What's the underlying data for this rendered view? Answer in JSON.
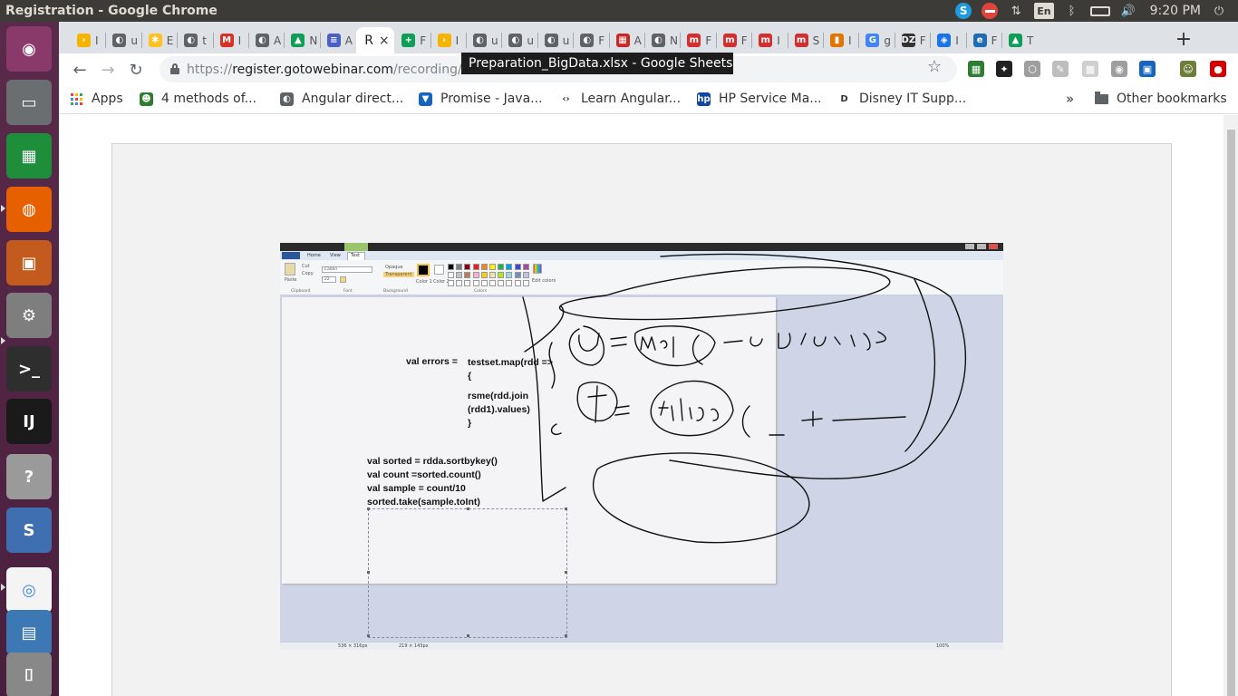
{
  "window": {
    "title": "Registration - Google Chrome"
  },
  "system_tray": {
    "skype_letter": "S",
    "keyboard_layout": "En",
    "bluetooth_glyph": "ᛒ",
    "network_glyph": "⇅",
    "volume_glyph": "🔊",
    "clock": "9:20 PM",
    "power_glyph": "⏻"
  },
  "launcher": [
    {
      "name": "ubuntu-dash",
      "color": "#8a3a6a",
      "glyph": "◉"
    },
    {
      "name": "files",
      "color": "#6b6e70",
      "glyph": "▭"
    },
    {
      "name": "libreoffice-calc",
      "color": "#1f8e3a",
      "glyph": "▦"
    },
    {
      "name": "firefox",
      "color": "#e66000",
      "glyph": "◍"
    },
    {
      "name": "libreoffice-impress",
      "color": "#c35b1e",
      "glyph": "▣"
    },
    {
      "name": "system-settings",
      "color": "#7e7e7e",
      "glyph": "⚙"
    },
    {
      "name": "terminal",
      "color": "#2e2e2e",
      "glyph": ">_"
    },
    {
      "name": "intellij-idea",
      "color": "#1a1a1a",
      "glyph": "IJ"
    },
    {
      "name": "help",
      "color": "#9a9a9a",
      "glyph": "?"
    },
    {
      "name": "stacked-apps",
      "color": "#3f6fb0",
      "glyph": "S"
    },
    {
      "name": "chrome",
      "color": "#f4f4f4",
      "glyph": "◎"
    },
    {
      "name": "virtualbox",
      "color": "#3c78b4",
      "glyph": "▤"
    },
    {
      "name": "disks",
      "color": "#888888",
      "glyph": "⌷"
    }
  ],
  "tabs": [
    {
      "label": "I",
      "favicon_color": "#f4b400",
      "glyph": "›"
    },
    {
      "label": "u",
      "favicon_color": "#5f6368",
      "glyph": "◐"
    },
    {
      "label": "E",
      "favicon_color": "#ffc220",
      "glyph": "✱"
    },
    {
      "label": "t",
      "favicon_color": "#5f6368",
      "glyph": "◐"
    },
    {
      "label": "I",
      "favicon_color": "#d93025",
      "glyph": "M"
    },
    {
      "label": "A",
      "favicon_color": "#5f6368",
      "glyph": "◐"
    },
    {
      "label": "N",
      "favicon_color": "#0f9d58",
      "glyph": "▲"
    },
    {
      "label": "A",
      "favicon_color": "#4b5fc9",
      "glyph": "≡"
    },
    {
      "label": "R",
      "favicon_color": "#ffffff",
      "glyph": ""
    },
    {
      "label": "F",
      "favicon_color": "#0f9d58",
      "glyph": "+"
    },
    {
      "label": "I",
      "favicon_color": "#f4b400",
      "glyph": "›"
    },
    {
      "label": "u",
      "favicon_color": "#5f6368",
      "glyph": "◐"
    },
    {
      "label": "u",
      "favicon_color": "#5f6368",
      "glyph": "◐"
    },
    {
      "label": "u",
      "favicon_color": "#5f6368",
      "glyph": "◐"
    },
    {
      "label": "F",
      "favicon_color": "#5f6368",
      "glyph": "◐"
    },
    {
      "label": "A",
      "favicon_color": "#c62828",
      "glyph": "▦"
    },
    {
      "label": "N",
      "favicon_color": "#5f6368",
      "glyph": "◐"
    },
    {
      "label": "F",
      "favicon_color": "#d32f2f",
      "glyph": "m"
    },
    {
      "label": "F",
      "favicon_color": "#d32f2f",
      "glyph": "m"
    },
    {
      "label": "I",
      "favicon_color": "#d32f2f",
      "glyph": "m"
    },
    {
      "label": "S",
      "favicon_color": "#d32f2f",
      "glyph": "m"
    },
    {
      "label": "I",
      "favicon_color": "#e37400",
      "glyph": "▮"
    },
    {
      "label": "g",
      "favicon_color": "#4285f4",
      "glyph": "G"
    },
    {
      "label": "F",
      "favicon_color": "#333333",
      "glyph": "DZ"
    },
    {
      "label": "I",
      "favicon_color": "#1a73e8",
      "glyph": "◈"
    },
    {
      "label": "F",
      "favicon_color": "#1f6bb5",
      "glyph": "e"
    },
    {
      "label": "T",
      "favicon_color": "#0f9d58",
      "glyph": "▲"
    }
  ],
  "active_tab": {
    "label": "R",
    "close": "×"
  },
  "new_tab_glyph": "+",
  "tooltip": "Preparation_BigData.xlsx - Google Sheets",
  "nav": {
    "back": "←",
    "forward": "→",
    "reload": "↻"
  },
  "omnibox": {
    "scheme": "https://",
    "host": "register.gotowebinar.com",
    "path": "/recording/459"
  },
  "bookmark_star": "☆",
  "extensions": [
    {
      "name": "ext-1",
      "color": "#2e7d32",
      "glyph": "▦"
    },
    {
      "name": "ext-2",
      "color": "#222222",
      "glyph": "✦"
    },
    {
      "name": "ext-3",
      "color": "#9e9e9e",
      "glyph": "⬡"
    },
    {
      "name": "ext-4",
      "color": "#bdbdbd",
      "glyph": "✎"
    },
    {
      "name": "ext-5",
      "color": "#cfcfcf",
      "glyph": "▩"
    },
    {
      "name": "ext-6",
      "color": "#9e9e9e",
      "glyph": "◉"
    },
    {
      "name": "ext-7",
      "color": "#1565c0",
      "glyph": "▣"
    },
    {
      "name": "ext-8",
      "color": "#6d7d3a",
      "glyph": "☺"
    },
    {
      "name": "ext-9",
      "color": "#d50000",
      "glyph": "●"
    }
  ],
  "bookmarks": {
    "apps": "Apps",
    "items": [
      {
        "label": "4 methods of...",
        "color": "#2e7d32",
        "glyph": "☻"
      },
      {
        "label": "Angular direct...",
        "color": "#5f6368",
        "glyph": "◐"
      },
      {
        "label": "Promise - Java...",
        "color": "#1565c0",
        "glyph": "▼"
      },
      {
        "label": "Learn Angular...",
        "color": "#ffffff",
        "glyph": "‹›"
      },
      {
        "label": "HP Service Ma...",
        "color": "#0d47a1",
        "glyph": "hp"
      },
      {
        "label": "Disney IT Supp...",
        "color": "#ffffff",
        "glyph": "D"
      }
    ],
    "overflow": "»",
    "other": "Other bookmarks"
  },
  "paint": {
    "ribbon": {
      "clipboard": "Clipboard",
      "font": "Font",
      "background": "Background",
      "colors": "Colors",
      "paste": "Paste",
      "cut": "Cut",
      "copy": "Copy",
      "font_name": "Calibri",
      "font_size": "22",
      "opaque": "Opaque",
      "transparent": "Transparent",
      "color1": "Color 1",
      "color2": "Color 2",
      "edit_colors": "Edit colors",
      "tab_home": "Home",
      "tab_view": "View",
      "tab_text": "Text"
    },
    "code_lines": {
      "errors_label": "val errors =",
      "map_line": "testset.map(rdd =>",
      "brace_open": "{",
      "rsme_line": "rsme(rdd.join",
      "values_line": "(rdd1).values)",
      "brace_close": "}",
      "sorted_line": "val sorted = rdda.sortbykey()",
      "count_line": "val count =sorted.count()",
      "sample_line": "val sample = count/10",
      "take_line": "sorted.take(sample.toInt)"
    },
    "status": {
      "canvas_size": "536 × 316px",
      "selection": "219 × 143px",
      "zoom": "100%"
    },
    "palette": [
      "#000000",
      "#7f7f7f",
      "#880015",
      "#ed1c24",
      "#ff7f27",
      "#fff200",
      "#22b14c",
      "#00a2e8",
      "#3f48cc",
      "#a349a4",
      "#ffffff",
      "#c3c3c3",
      "#b97a57",
      "#ffaec9",
      "#ffc90e",
      "#efe4b0",
      "#b5e61d",
      "#99d9ea",
      "#7092be",
      "#c8bfe7"
    ]
  }
}
